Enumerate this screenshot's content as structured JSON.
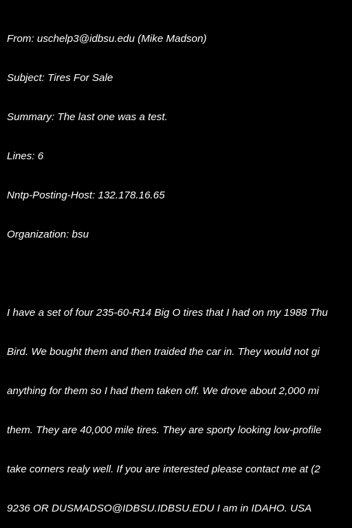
{
  "email": {
    "header": {
      "from": "From: uschelp3@idbsu.edu (Mike Madson)",
      "subject": "Subject: Tires For Sale",
      "summary": "Summary: The last one was a test.",
      "lines": "Lines: 6",
      "nntp_posting_host": "Nntp-Posting-Host: 132.178.16.65",
      "organization": "Organization: bsu"
    },
    "body_lines": [
      "I have a set of four 235-60-R14 Big O tires that I had on my 1988 Thu",
      "Bird. We bought them and then traided the car in. They would not gi",
      "anything for them so I had them taken off. We drove about 2,000 mi",
      "them. They are 40,000 mile tires. They are sporty looking low-profile",
      "take corners realy well. If you are interested please contact me at (2",
      "9236 OR DUSMADSO@IDBSU.IDBSU.EDU I am in IDAHO. USA"
    ]
  },
  "colors": {
    "background": "#000000",
    "text": "#ffffff"
  }
}
